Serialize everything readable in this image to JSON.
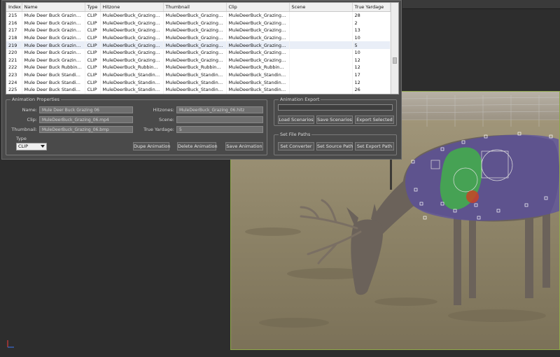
{
  "table": {
    "columns": [
      "Index",
      "Name",
      "Type",
      "Hitzone",
      "Thumbnail",
      "Clip",
      "Scene",
      "True Yardage"
    ],
    "rows": [
      [
        "215",
        "Mule Deer Buck Grazing 02",
        "CLIP",
        "MuleDeerBuck_Grazing_02.hitz",
        "MuleDeerBuck_Grazing_02.mp4",
        "MuleDeerBuck_Grazing_02.bmp",
        "",
        "28"
      ],
      [
        "216",
        "Mule Deer Buck Grazing 03",
        "CLIP",
        "MuleDeerBuck_Grazing_03.hitz",
        "MuleDeerBuck_Grazing_03.mp4",
        "MuleDeerBuck_Grazing_03.bmp",
        "",
        "2"
      ],
      [
        "217",
        "Mule Deer Buck Grazing 04",
        "CLIP",
        "MuleDeerBuck_Grazing_04.hitz",
        "MuleDeerBuck_Grazing_04.mp4",
        "MuleDeerBuck_Grazing_04.bmp",
        "",
        "13"
      ],
      [
        "218",
        "Mule Deer Buck Grazing 05",
        "CLIP",
        "MuleDeerBuck_Grazing_05.hitz",
        "MuleDeerBuck_Grazing_05.mp4",
        "MuleDeerBuck_Grazing_05.bmp",
        "",
        "10"
      ],
      [
        "219",
        "Mule Deer Buck Grazing 06",
        "CLIP",
        "MuleDeerBuck_Grazing_06.hitz",
        "MuleDeerBuck_Grazing_06.mp4",
        "MuleDeerBuck_Grazing_06.bmp",
        "",
        "5"
      ],
      [
        "220",
        "Mule Deer Buck Grazing 07",
        "CLIP",
        "MuleDeerBuck_Grazing_07.hitz",
        "MuleDeerBuck_Grazing_07.mp4",
        "MuleDeerBuck_Grazing_07.bmp",
        "",
        "10"
      ],
      [
        "221",
        "Mule Deer Buck Grazing 08",
        "CLIP",
        "MuleDeerBuck_Grazing_08.hitz",
        "MuleDeerBuck_Grazing_08.mp4",
        "MuleDeerBuck_Grazing_08.bmp",
        "",
        "12"
      ],
      [
        "222",
        "Mule Deer Buck Rubbing 01",
        "CLIP",
        "MuleDeerBuck_Rubbing_01.hitz",
        "MuleDeerBuck_Rubbing_01.mp4",
        "MuleDeerBuck_Rubbing_01.b...",
        "",
        "12"
      ],
      [
        "223",
        "Mule Deer Buck Standing 01",
        "CLIP",
        "MuleDeerBuck_Standing_01....",
        "MuleDeerBuck_Standing_01....",
        "MuleDeerBuck_Standing_01....",
        "",
        "17"
      ],
      [
        "224",
        "Mule Deer Buck Standing 02",
        "CLIP",
        "MuleDeerBuck_Standing_02....",
        "MuleDeerBuck_Standing_02....",
        "MuleDeerBuck_Standing_02....",
        "",
        "12"
      ],
      [
        "225",
        "Mule Deer Buck Standing 04",
        "CLIP",
        "MuleDeerBuck_Standing_04....",
        "MuleDeerBuck_Standing_04....",
        "MuleDeerBuck_Standing_04....",
        "",
        "26"
      ],
      [
        "226",
        "Mule Deer Doe Grazing 01",
        "CLIP",
        "MuleDeerDoe_Grazing_01.hitz",
        "MuleDeerDoe_Grazing_01.mp4",
        "MuleDeerDoe_Grazing_01.bmp",
        "",
        "15"
      ],
      [
        "227",
        "Mule Deer Doe Grazing 02",
        "CLIP",
        "MuleDeerDoe_Grazing_02.hitz",
        "MuleDeerDoe_Grazing_02.mp4",
        "MuleDeerDoe_Grazing_02.bmp",
        "",
        "17"
      ]
    ]
  },
  "animation_properties": {
    "title": "Animation Properties",
    "name_label": "Name:",
    "name_value": "Mule Deer Buck Grazing 06",
    "clip_label": "Clip:",
    "clip_value": "MuleDeerBuck_Grazing_06.mp4",
    "thumbnail_label": "Thumbnail:",
    "thumbnail_value": "MuleDeerBuck_Grazing_06.bmp",
    "hitzones_label": "Hitzones:",
    "hitzones_value": "MuleDeerBuck_Grazing_06.hitz",
    "scene_label": "Scene:",
    "scene_value": "",
    "yardage_label": "True Yardage:",
    "yardage_value": "5",
    "type_label": "Type",
    "type_value": "CLIP",
    "dupe_button": "Dupe Animation",
    "delete_button": "Delete Animation",
    "save_button": "Save Animation"
  },
  "animation_export": {
    "title": "Animation Export",
    "load_button": "Load Scenarios",
    "save_button": "Save Scenarios",
    "export_button": "Export Selected"
  },
  "file_paths": {
    "title": "Set File Paths",
    "converter_button": "Set Converter",
    "source_button": "Set Source Path",
    "export_button": "Set Export Path"
  },
  "colors": {
    "window_bg": "#4a4a4a",
    "viewport_border": "#8fa84a",
    "hitzone_body": "#5a4fa0",
    "hitzone_vital": "#3cc43c",
    "hitzone_heart": "#d04020"
  }
}
